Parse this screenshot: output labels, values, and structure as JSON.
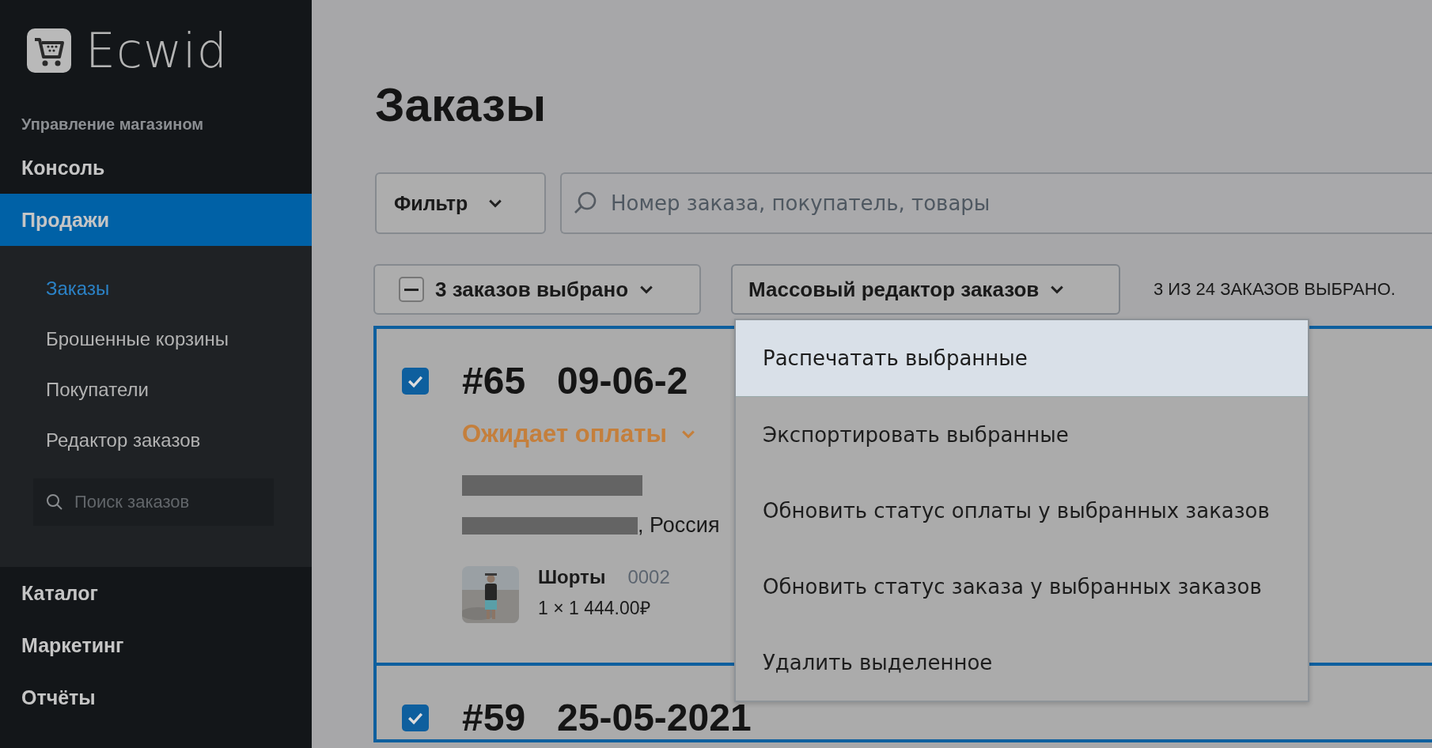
{
  "logo": {
    "text": "Ecwid"
  },
  "sidebar": {
    "section_label": "Управление магазином",
    "items": [
      {
        "label": "Консоль",
        "selected": false,
        "expanded": false
      },
      {
        "label": "Продажи",
        "selected": true,
        "expanded": true,
        "children": [
          {
            "label": "Заказы",
            "selected": true
          },
          {
            "label": "Брошенные корзины",
            "selected": false
          },
          {
            "label": "Покупатели",
            "selected": false
          },
          {
            "label": "Редактор заказов",
            "selected": false
          }
        ],
        "search": {
          "placeholder": "Поиск заказов"
        }
      },
      {
        "label": "Каталог",
        "selected": false,
        "expanded": false
      },
      {
        "label": "Маркетинг",
        "selected": false,
        "expanded": false
      },
      {
        "label": "Отчёты",
        "selected": false,
        "expanded": false
      }
    ]
  },
  "page": {
    "title": "Заказы",
    "filter_button": "Фильтр",
    "search": {
      "placeholder": "Номер заказа, покупатель, товары"
    },
    "selection_button": {
      "label": "3 заказов выбрано",
      "indeterminate": true
    },
    "mass_edit_button": {
      "label": "Массовый редактор заказов",
      "expanded": true
    },
    "selection_summary": "3 ИЗ 24 ЗАКАЗОВ ВЫБРАНО.",
    "menu": [
      {
        "label": "Распечатать выбранные",
        "selected": true
      },
      {
        "label": "Экспортировать выбранные",
        "selected": false
      },
      {
        "label": "Обновить статус оплаты у выбранных заказов",
        "selected": false
      },
      {
        "label": "Обновить статус заказа у выбранных заказов",
        "selected": false
      },
      {
        "label": "Удалить выделенное",
        "selected": false
      }
    ],
    "orders": [
      {
        "number": "#65",
        "date": "09-06-2",
        "checked": true,
        "status": "Ожидает оплаты",
        "redacted": true,
        "address_suffix": ", Россия",
        "products": [
          {
            "kind": "picture",
            "name": "Шорты",
            "sku": "0002",
            "price": "1 × 1 444.00₽"
          }
        ]
      },
      {
        "number": "#59",
        "date": "25-05-2021",
        "checked": true
      }
    ]
  }
}
